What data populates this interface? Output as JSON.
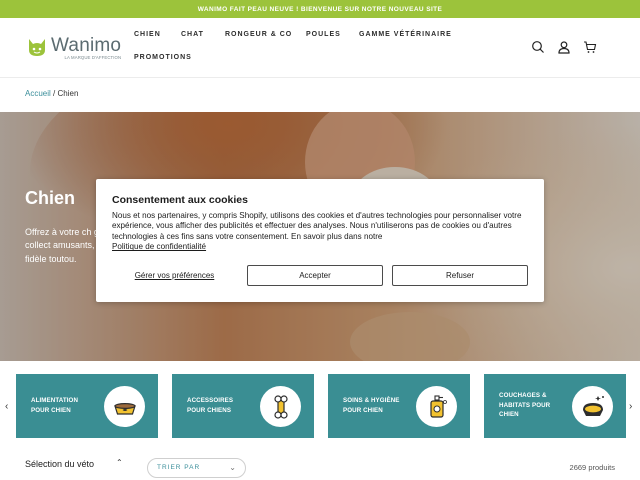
{
  "announcement": "WANIMO FAIT PEAU NEUVE ! BIENVENUE SUR NOTRE NOUVEAU SITE",
  "logo": {
    "name": "Wanimo",
    "tagline": "LA MARQUE D'AFFECTION"
  },
  "nav": [
    "CHIEN",
    "CHAT",
    "RONGEUR & CO",
    "POULES",
    "GAMME VÉTÉRINAIRE",
    "PROMOTIONS"
  ],
  "header_icons": [
    "search-icon",
    "account-icon",
    "cart-icon"
  ],
  "breadcrumb": {
    "home": "Accueil",
    "separator": "/",
    "current": "Chien"
  },
  "hero": {
    "title": "Chien",
    "description": "Offrez à votre ch grâce à la collect amusants, et des fidèle toutou."
  },
  "cookie": {
    "title": "Consentement aux cookies",
    "body": "Nous et nos partenaires, y compris Shopify, utilisons des cookies et d'autres technologies pour personnaliser votre expérience, vous afficher des publicités et effectuer des analyses. Nous n'utiliserons pas de cookies ou d'autres technologies à ces fins sans votre consentement. En savoir plus dans notre",
    "policy_link": "Politique de confidentialité",
    "manage": "Gérer vos préférences",
    "accept": "Accepter",
    "decline": "Refuser"
  },
  "categories": [
    {
      "line1": "ALIMENTATION",
      "line2": "POUR CHIEN",
      "line3": "",
      "icon": "dog-bowl-icon"
    },
    {
      "line1": "ACCESSOIRES",
      "line2": "POUR CHIENS",
      "line3": "",
      "icon": "dog-bone-icon"
    },
    {
      "line1": "SOINS & HYGIÈNE",
      "line2": "POUR CHIEN",
      "line3": "",
      "icon": "shampoo-icon"
    },
    {
      "line1": "COUCHAGES &",
      "line2": "HABITATS POUR",
      "line3": "CHIEN",
      "icon": "dog-bed-icon"
    }
  ],
  "filter": {
    "label": "Sélection du véto",
    "sort": "TRIER PAR"
  },
  "product_count": "2669 produits",
  "colors": {
    "accent_green": "#9cc33b",
    "teal": "#3a8e93",
    "link": "#3a8e9a"
  }
}
